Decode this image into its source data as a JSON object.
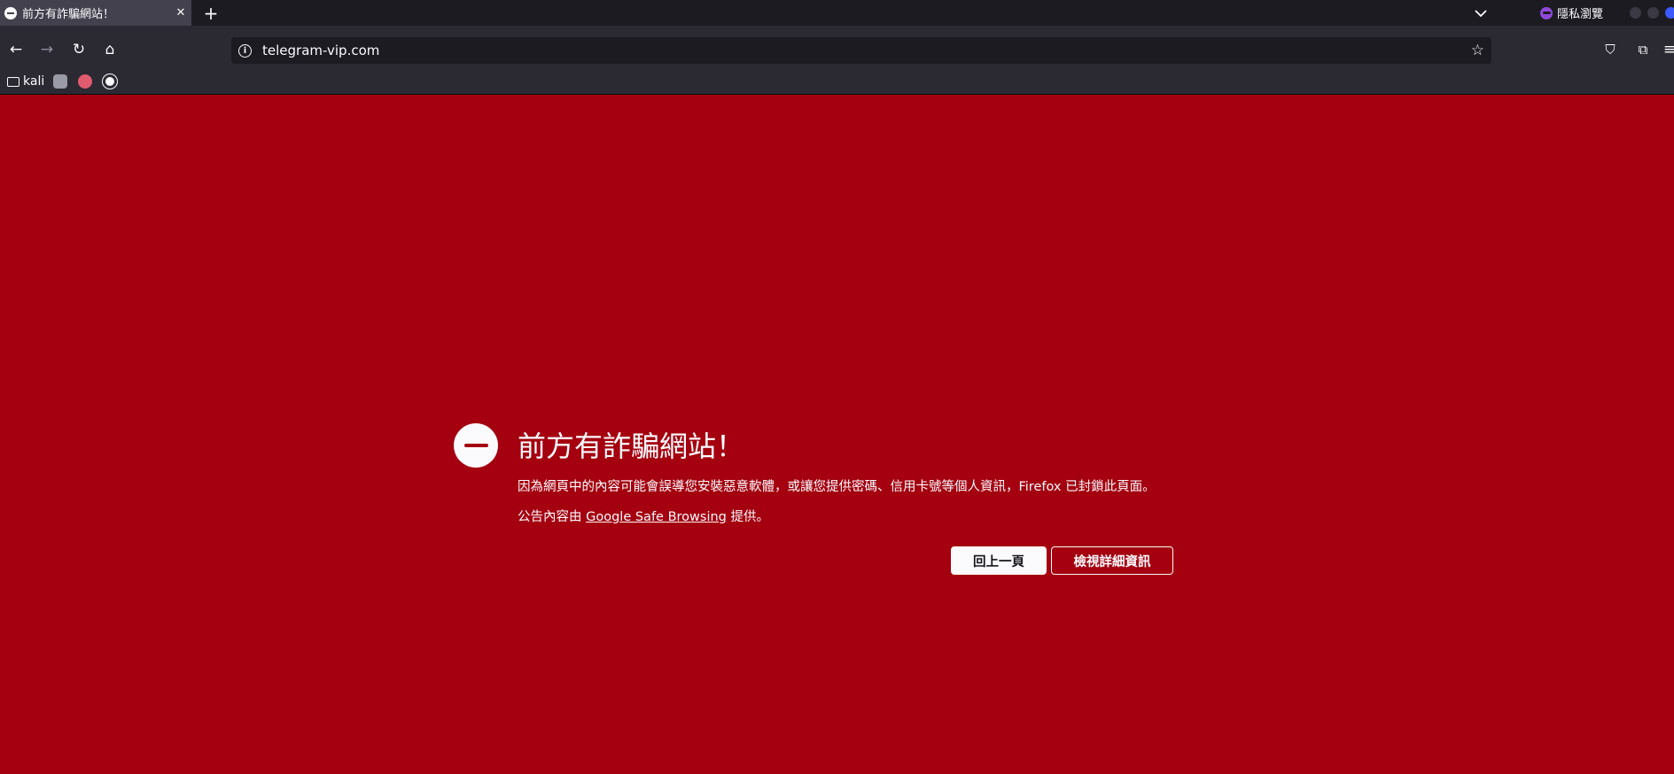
{
  "tab": {
    "title": "前方有詐騙網站！",
    "close_glyph": "✕"
  },
  "tabbar": {
    "new_tab_glyph": "+",
    "list_tabs_glyph": "⌄",
    "private_label": "隱私瀏覽"
  },
  "nav": {
    "back_glyph": "←",
    "forward_glyph": "→",
    "reload_glyph": "↻",
    "home_glyph": "⌂",
    "url": "telegram-vip.com",
    "info_glyph": "i",
    "star_glyph": "☆",
    "pocket_glyph": "⛉",
    "extensions_glyph": "⧉",
    "menu_glyph": "≡"
  },
  "bookmarks": {
    "folder_label": "kali"
  },
  "error": {
    "title": "前方有詐騙網站！",
    "description": "因為網頁中的內容可能會誤導您安裝惡意軟體，或讓您提供密碼、信用卡號等個人資訊，Firefox 已封鎖此頁面。",
    "attribution_prefix": "公告內容由",
    "attribution_link": "Google Safe Browsing",
    "attribution_suffix": "提供。",
    "back_button": "回上一頁",
    "details_button": "檢視詳細資訊"
  },
  "colors": {
    "page_background": "#a4000f",
    "chrome_dark": "#1c1b22",
    "chrome": "#2b2a33",
    "text_light": "#fbfbfe"
  }
}
